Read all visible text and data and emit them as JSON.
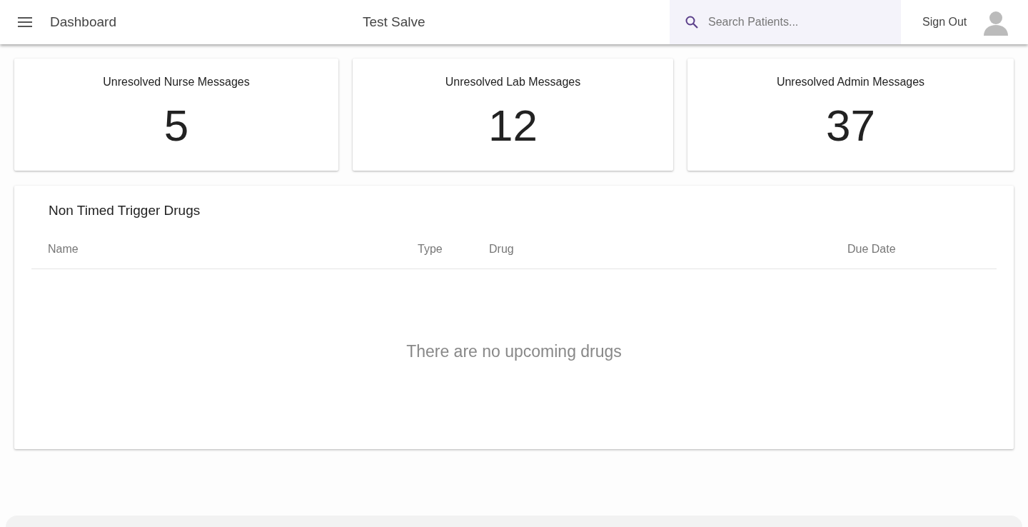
{
  "header": {
    "title": "Dashboard",
    "app_name": "Test Salve",
    "search": {
      "placeholder": "Search Patients..."
    },
    "sign_out": "Sign Out"
  },
  "stats": [
    {
      "label": "Unresolved Nurse Messages",
      "value": "5"
    },
    {
      "label": "Unresolved Lab Messages",
      "value": "12"
    },
    {
      "label": "Unresolved Admin Messages",
      "value": "37"
    }
  ],
  "table": {
    "title": "Non Timed Trigger Drugs",
    "columns": [
      "Name",
      "Type",
      "Drug",
      "Due Date"
    ],
    "empty_message": "There are no upcoming drugs"
  }
}
